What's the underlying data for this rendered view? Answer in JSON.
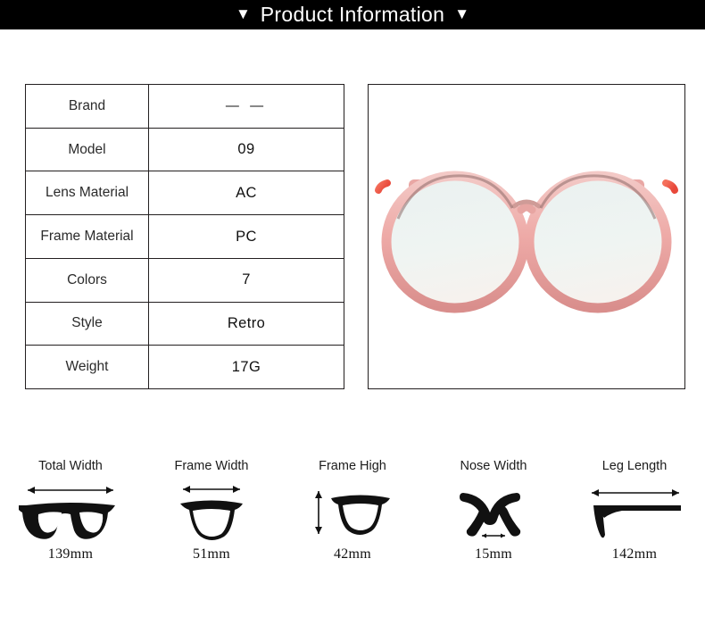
{
  "header": {
    "title": "Product Information",
    "caret_left": "▼",
    "caret_right": "▼",
    "background_color": "#000000",
    "text_color": "#ffffff"
  },
  "spec_table": {
    "rows": [
      {
        "label": "Brand",
        "value": "— —"
      },
      {
        "label": "Model",
        "value": "09"
      },
      {
        "label": "Lens Material",
        "value": "AC"
      },
      {
        "label": "Frame Material",
        "value": "PC"
      },
      {
        "label": "Colors",
        "value": "7"
      },
      {
        "label": "Style",
        "value": "Retro"
      },
      {
        "label": "Weight",
        "value": "17G"
      }
    ],
    "border_color": "#231f20"
  },
  "product_photo": {
    "alt": "eyeglasses-front-view",
    "frame_color": "#e8a7a6",
    "frame_accent_color": "#f0503c",
    "lens_color": "#eef3f2",
    "background_color": "#ffffff"
  },
  "measurements": [
    {
      "label": "Total Width",
      "value": "139mm",
      "icon": "glasses-full-front-icon",
      "arrow": "horizontal"
    },
    {
      "label": "Frame Width",
      "value": "51mm",
      "icon": "glasses-single-lens-icon",
      "arrow": "horizontal"
    },
    {
      "label": "Frame High",
      "value": "42mm",
      "icon": "glasses-single-lens-icon",
      "arrow": "vertical"
    },
    {
      "label": "Nose Width",
      "value": "15mm",
      "icon": "glasses-bridge-icon",
      "arrow": "horizontal"
    },
    {
      "label": "Leg Length",
      "value": "142mm",
      "icon": "glasses-temple-arm-icon",
      "arrow": "horizontal"
    }
  ]
}
